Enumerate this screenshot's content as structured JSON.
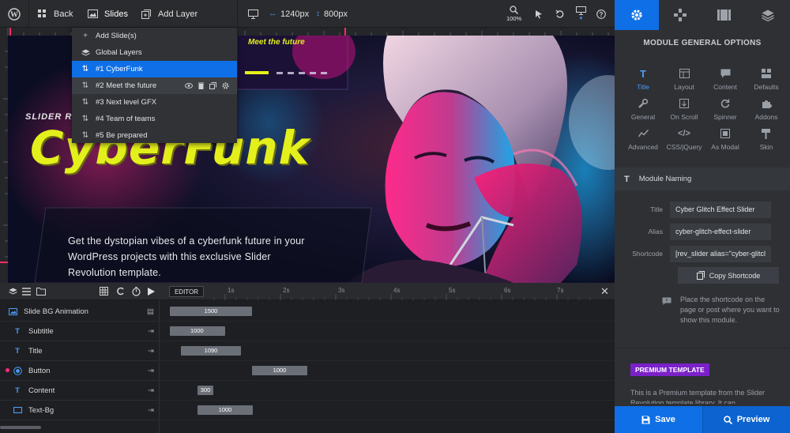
{
  "topbar": {
    "back_label": "Back",
    "slides_label": "Slides",
    "add_layer_label": "Add Layer",
    "width_value": "1240px",
    "height_value": "800px",
    "zoom_label": "100%"
  },
  "slides_menu": {
    "items": [
      {
        "label": "Add Slide(s)",
        "icon": "plus-icon"
      },
      {
        "label": "Global Layers",
        "icon": "layers-icon"
      },
      {
        "label": "#1 CyberFunk",
        "icon": "sort-icon",
        "state": "active"
      },
      {
        "label": "#2 Meet the future",
        "icon": "sort-icon",
        "state": "hover"
      },
      {
        "label": "#3 Next level GFX",
        "icon": "sort-icon"
      },
      {
        "label": "#4 Team of teams",
        "icon": "sort-icon"
      },
      {
        "label": "#5 Be prepared",
        "icon": "sort-icon"
      }
    ],
    "preview_title": "Meet the future"
  },
  "stage": {
    "kicker": "SLIDER RE",
    "headline": "CyberFunk",
    "body": [
      "Get the dystopian vibes of a cyberfunk future in your",
      "WordPress projects with this exclusive Slider",
      "Revolution template."
    ],
    "colors": {
      "accent": "#e4f01b",
      "magenta": "#ff1f7a",
      "cyan": "#0fd0ff"
    }
  },
  "timeline": {
    "editor_label": "EDITOR",
    "ticks": [
      "1s",
      "2s",
      "3s",
      "4s",
      "5s",
      "6s",
      "7s"
    ],
    "rows": [
      {
        "label": "Slide BG Animation",
        "icon": "image-icon",
        "bar": "1500"
      },
      {
        "label": "Subtitle",
        "icon": "text-icon",
        "bar": "1000"
      },
      {
        "label": "Title",
        "icon": "text-icon",
        "bar": "1090"
      },
      {
        "label": "Button",
        "icon": "button-icon",
        "bar": "1000"
      },
      {
        "label": "Content",
        "icon": "text-icon",
        "bar": "300"
      },
      {
        "label": "Text-Bg",
        "icon": "shape-icon",
        "bar": "1000"
      }
    ]
  },
  "panel": {
    "title": "MODULE GENERAL OPTIONS",
    "options": [
      {
        "label": "Title",
        "icon": "title-icon"
      },
      {
        "label": "Layout",
        "icon": "layout-icon"
      },
      {
        "label": "Content",
        "icon": "content-icon"
      },
      {
        "label": "Defaults",
        "icon": "defaults-icon"
      },
      {
        "label": "General",
        "icon": "wrench-icon"
      },
      {
        "label": "On Scroll",
        "icon": "scroll-icon"
      },
      {
        "label": "Spinner",
        "icon": "spinner-icon"
      },
      {
        "label": "Addons",
        "icon": "puzzle-icon"
      },
      {
        "label": "Advanced",
        "icon": "chart-icon"
      },
      {
        "label": "CSS/jQuery",
        "icon": "code-icon"
      },
      {
        "label": "As Modal",
        "icon": "modal-icon"
      },
      {
        "label": "Skin",
        "icon": "brush-icon"
      }
    ],
    "naming_header": "Module Naming",
    "fields": [
      {
        "label": "Title",
        "value": "Cyber Glitch Effect Slider"
      },
      {
        "label": "Alias",
        "value": "cyber-glitch-effect-slider"
      },
      {
        "label": "Shortcode",
        "value": "[rev_slider alias=\"cyber-glitcl"
      }
    ],
    "copy_label": "Copy Shortcode",
    "hint": "Place the shortcode on the page or post where you want to show this module.",
    "premium_badge": "PREMIUM TEMPLATE",
    "premium_text": "This is a Premium template from the Slider Revolution template library. It can",
    "save_label": "Save",
    "preview_label": "Preview",
    "accent_color": "#0f6fe6"
  }
}
